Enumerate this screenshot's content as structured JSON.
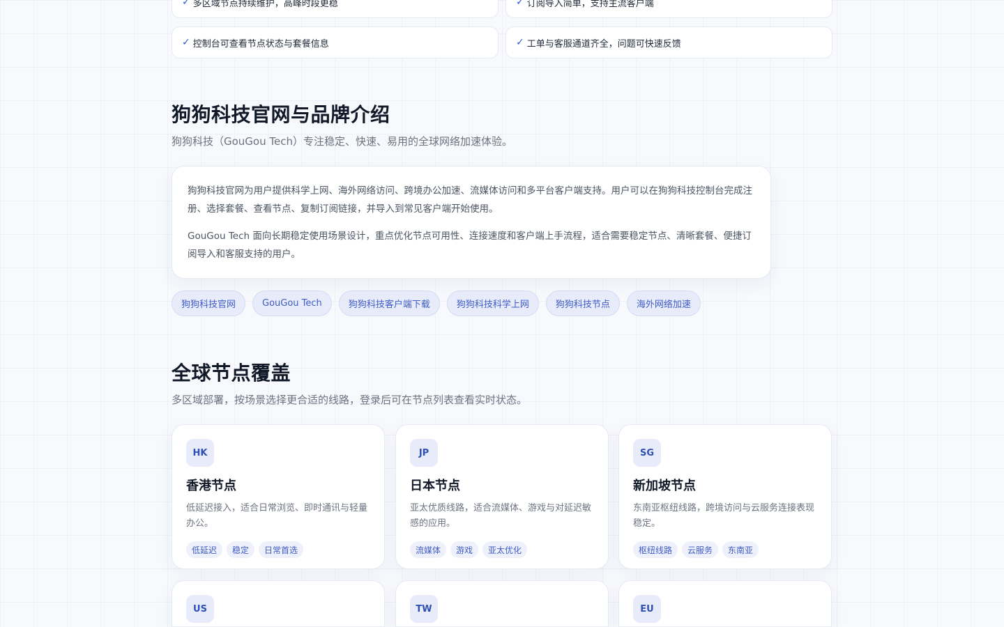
{
  "features": [
    {
      "text": "多区域节点持续维护，高峰时段更稳"
    },
    {
      "text": "订阅导入简单，支持主流客户端"
    },
    {
      "text": "控制台可查看节点状态与套餐信息"
    },
    {
      "text": "工单与客服通道齐全，问题可快速反馈"
    }
  ],
  "check_glyph": "✓",
  "brand_section": {
    "title": "狗狗科技官网与品牌介绍",
    "subtitle": "狗狗科技（GouGou Tech）专注稳定、快速、易用的全球网络加速体验。",
    "paragraphs": [
      "狗狗科技官网为用户提供科学上网、海外网络访问、跨境办公加速、流媒体访问和多平台客户端支持。用户可以在狗狗科技控制台完成注册、选择套餐、查看节点、复制订阅链接，并导入到常见客户端开始使用。",
      "GouGou Tech 面向长期稳定使用场景设计，重点优化节点可用性、连接速度和客户端上手流程，适合需要稳定节点、清晰套餐、便捷订阅导入和客服支持的用户。"
    ],
    "tags": [
      "狗狗科技官网",
      "GouGou Tech",
      "狗狗科技客户端下载",
      "狗狗科技科学上网",
      "狗狗科技节点",
      "海外网络加速"
    ]
  },
  "nodes_section": {
    "title": "全球节点覆盖",
    "subtitle": "多区域部署，按场景选择更合适的线路，登录后可在节点列表查看实时状态。",
    "nodes": [
      {
        "code": "HK",
        "title": "香港节点",
        "desc": "低延迟接入，适合日常浏览、即时通讯与轻量办公。",
        "tags": [
          "低延迟",
          "稳定",
          "日常首选"
        ]
      },
      {
        "code": "JP",
        "title": "日本节点",
        "desc": "亚太优质线路，适合流媒体、游戏与对延迟敏感的应用。",
        "tags": [
          "流媒体",
          "游戏",
          "亚太优化"
        ]
      },
      {
        "code": "SG",
        "title": "新加坡节点",
        "desc": "东南亚枢纽线路，跨境访问与云服务连接表现稳定。",
        "tags": [
          "枢纽线路",
          "云服务",
          "东南亚"
        ]
      },
      {
        "code": "US"
      },
      {
        "code": "TW"
      },
      {
        "code": "EU"
      }
    ]
  },
  "colors": {
    "accent": "#2f5bd3",
    "pill_bg": "#e8ecfa",
    "heading": "#111827",
    "muted": "#6b7280"
  }
}
